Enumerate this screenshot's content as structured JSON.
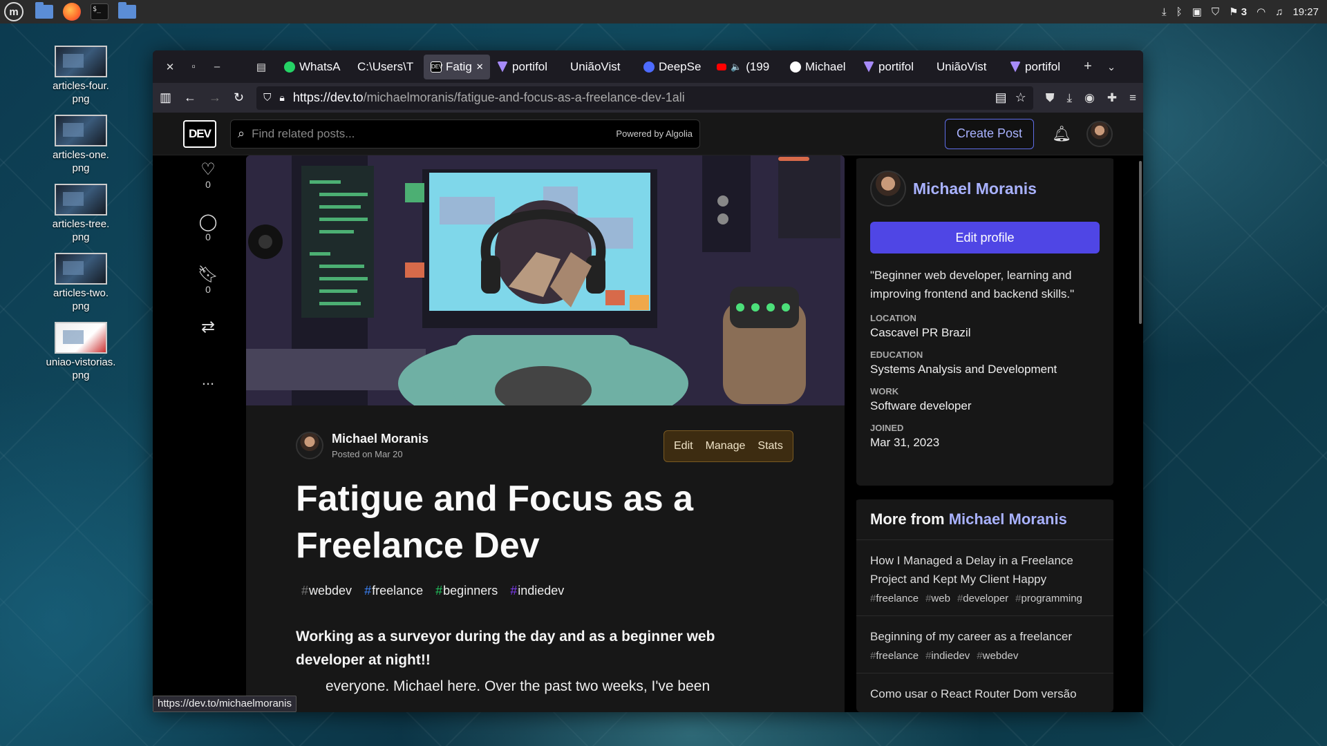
{
  "panel": {
    "launcher_label": "m",
    "tray_icons": [
      "download-icon",
      "bluetooth-icon",
      "clipboard-icon",
      "shield-icon",
      "notifications-icon",
      "wifi-icon",
      "music-icon"
    ],
    "notification_count": "3",
    "clock": "19:27"
  },
  "desktop": {
    "icons": [
      {
        "label": "articles-four.\npng"
      },
      {
        "label": "articles-one.\npng"
      },
      {
        "label": "articles-tree.\npng"
      },
      {
        "label": "articles-two.\npng"
      },
      {
        "label": "uniao-vistorias.\npng"
      }
    ]
  },
  "browser": {
    "tabs": [
      {
        "label": "WhatsA",
        "color": "#25d366"
      },
      {
        "label": "C:\\Users\\T",
        "color": "#555555"
      },
      {
        "label": "Fatig",
        "color": "#000000",
        "active": true
      },
      {
        "label": "portifol",
        "color": "#a78bfa"
      },
      {
        "label": "UniãoVist",
        "color": "#555555"
      },
      {
        "label": "DeepSe",
        "color": "#4d6bfe"
      },
      {
        "label": "(199",
        "color": "#ff0000"
      },
      {
        "label": "Michael",
        "color": "#ffffff"
      },
      {
        "label": "portifol",
        "color": "#a78bfa"
      },
      {
        "label": "UniãoVist",
        "color": "#555555"
      },
      {
        "label": "portifol",
        "color": "#a78bfa"
      }
    ],
    "url_host": "https://dev.to",
    "url_path": "/michaelmoranis/fatigue-and-focus-as-a-freelance-dev-1ali",
    "status_url": "https://dev.to/michaelmoranis"
  },
  "dev": {
    "logo": "DEV",
    "search_placeholder": "Find related posts...",
    "powered_by": "Powered by Algolia",
    "create_post": "Create Post",
    "reactions": [
      {
        "icon": "heart-add-icon",
        "count": "0"
      },
      {
        "icon": "comment-icon",
        "count": "0"
      },
      {
        "icon": "bookmark-icon",
        "count": "0"
      },
      {
        "icon": "repost-icon",
        "count": ""
      }
    ],
    "more_label": "...",
    "article": {
      "author": "Michael Moranis",
      "posted": "Posted on Mar 20",
      "actions": [
        "Edit",
        "Manage",
        "Stats"
      ],
      "title": "Fatigue and Focus as a Freelance Dev",
      "tags": [
        "webdev",
        "freelance",
        "beginners",
        "indiedev"
      ],
      "tag_colors": [
        "#777777",
        "#3b82f6",
        "#22c55e",
        "#7c3aed"
      ],
      "lead": "Working as a surveyor during the day and as a beginner web developer at night!!",
      "body": "everyone. Michael here. Over the past two weeks, I've been"
    },
    "profile": {
      "name": "Michael Moranis",
      "edit_profile": "Edit profile",
      "bio": "\"Beginner web developer, learning and improving frontend and backend skills.\"",
      "fields": [
        {
          "key": "Location",
          "value": "Cascavel PR Brazil"
        },
        {
          "key": "Education",
          "value": "Systems Analysis and Development"
        },
        {
          "key": "Work",
          "value": "Software developer"
        },
        {
          "key": "Joined",
          "value": "Mar 31, 2023"
        }
      ]
    },
    "more_from": {
      "prefix": "More from",
      "author": "Michael Moranis",
      "items": [
        {
          "title": "How I Managed a Delay in a Freelance Project and Kept My Client Happy",
          "tags": [
            "freelance",
            "web",
            "developer",
            "programming"
          ]
        },
        {
          "title": "Beginning of my career as a freelancer",
          "tags": [
            "freelance",
            "indiedev",
            "webdev"
          ]
        },
        {
          "title": "Como usar o React Router Dom versão",
          "tags": []
        }
      ]
    }
  }
}
